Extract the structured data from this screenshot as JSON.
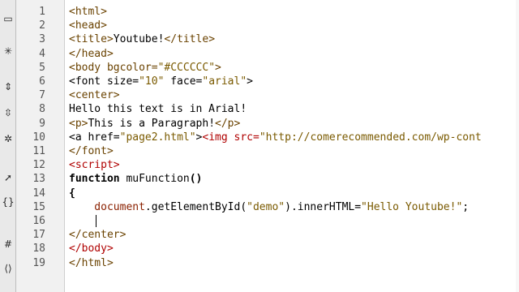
{
  "toolbar": {
    "icons": [
      {
        "name": "new-file-icon",
        "glyph": "▭"
      },
      {
        "name": "settings-icon",
        "glyph": "✳"
      },
      {
        "name": "expand-icon",
        "glyph": "⇕"
      },
      {
        "name": "collapse-icon",
        "glyph": "⇳"
      },
      {
        "name": "select-icon",
        "glyph": "✲"
      },
      {
        "name": "cursor-icon",
        "glyph": "➚"
      },
      {
        "name": "braces-icon",
        "glyph": "{}"
      },
      {
        "name": "snippet-icon",
        "glyph": "#"
      },
      {
        "name": "indent-icon",
        "glyph": "⟨⟩"
      }
    ]
  },
  "editor": {
    "line_numbers": [
      "1",
      "2",
      "3",
      "4",
      "5",
      "6",
      "7",
      "8",
      "9",
      "10",
      "11",
      "12",
      "13",
      "14",
      "15",
      "16",
      "17",
      "18",
      "19"
    ],
    "lines": [
      {
        "segments": [
          {
            "t": "<html>",
            "c": "tag"
          }
        ]
      },
      {
        "segments": [
          {
            "t": "<head>",
            "c": "tag"
          }
        ]
      },
      {
        "segments": [
          {
            "t": "<title>",
            "c": "tag"
          },
          {
            "t": "Youtube!",
            "c": "txt"
          },
          {
            "t": "</title>",
            "c": "tag"
          }
        ]
      },
      {
        "segments": [
          {
            "t": "</head>",
            "c": "tag"
          }
        ]
      },
      {
        "segments": [
          {
            "t": "<body bgcolor=",
            "c": "tag"
          },
          {
            "t": "\"#CCCCCC\"",
            "c": "str"
          },
          {
            "t": ">",
            "c": "tag"
          }
        ]
      },
      {
        "segments": [
          {
            "t": "<font size=",
            "c": "txt"
          },
          {
            "t": "\"10\"",
            "c": "str"
          },
          {
            "t": " face=",
            "c": "txt"
          },
          {
            "t": "\"arial\"",
            "c": "str"
          },
          {
            "t": ">",
            "c": "txt"
          }
        ]
      },
      {
        "segments": [
          {
            "t": "<center>",
            "c": "tag"
          }
        ]
      },
      {
        "segments": [
          {
            "t": "Hello this text is in Arial!",
            "c": "txt"
          }
        ]
      },
      {
        "segments": [
          {
            "t": "<p>",
            "c": "tag"
          },
          {
            "t": "This is a Paragraph!",
            "c": "txt"
          },
          {
            "t": "</p>",
            "c": "tag"
          }
        ]
      },
      {
        "segments": [
          {
            "t": "<a href=",
            "c": "txt"
          },
          {
            "t": "\"page2.html\"",
            "c": "str"
          },
          {
            "t": ">",
            "c": "txt"
          },
          {
            "t": "<img src=",
            "c": "red"
          },
          {
            "t": "\"http://comerecommended.com/wp-cont",
            "c": "str"
          }
        ]
      },
      {
        "segments": [
          {
            "t": "</font>",
            "c": "tag"
          }
        ]
      },
      {
        "segments": [
          {
            "t": "<script>",
            "c": "red"
          }
        ]
      },
      {
        "segments": [
          {
            "t": "function",
            "c": "kw"
          },
          {
            "t": " muFunction",
            "c": "txt"
          },
          {
            "t": "()",
            "c": "kw"
          }
        ]
      },
      {
        "segments": [
          {
            "t": "{",
            "c": "kw"
          }
        ]
      },
      {
        "segments": [
          {
            "t": "    document",
            "c": "fn"
          },
          {
            "t": ".getElementById(",
            "c": "txt"
          },
          {
            "t": "\"demo\"",
            "c": "str"
          },
          {
            "t": ").innerHTML=",
            "c": "txt"
          },
          {
            "t": "\"Hello Youtube!\"",
            "c": "str"
          },
          {
            "t": ";",
            "c": "txt"
          }
        ]
      },
      {
        "segments": [
          {
            "t": "",
            "c": "txt"
          }
        ]
      },
      {
        "segments": [
          {
            "t": "</center>",
            "c": "tag"
          }
        ]
      },
      {
        "segments": [
          {
            "t": "</body>",
            "c": "red"
          }
        ]
      },
      {
        "segments": [
          {
            "t": "</html>",
            "c": "tag"
          }
        ]
      }
    ]
  }
}
